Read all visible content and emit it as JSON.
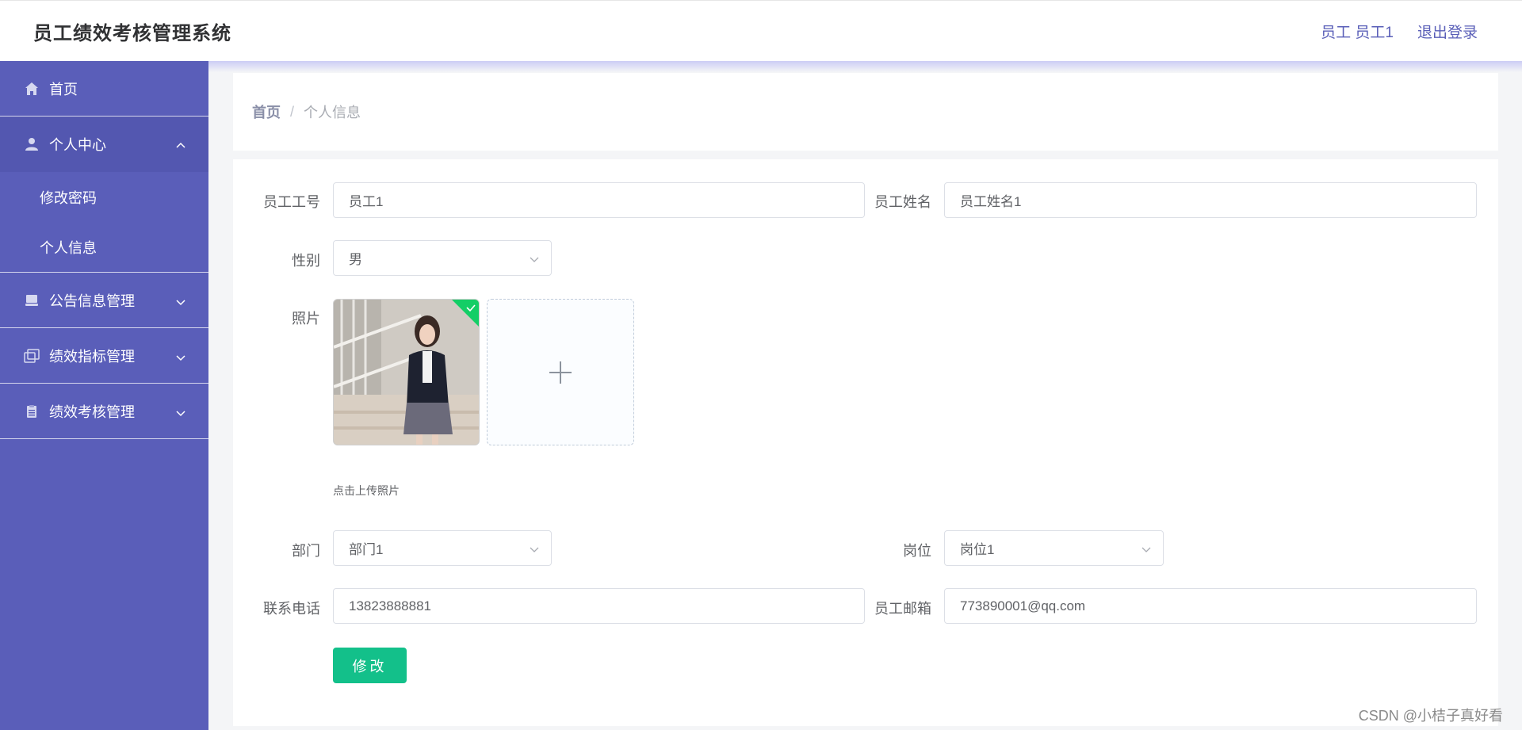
{
  "app": {
    "title": "员工绩效考核管理系统"
  },
  "header": {
    "user_label": "员工 员工1",
    "logout_label": "退出登录"
  },
  "sidebar": {
    "home": {
      "label": "首页",
      "icon": "home-icon"
    },
    "personal_center": {
      "label": "个人中心",
      "icon": "user-icon",
      "expanded": true,
      "children": [
        {
          "label": "修改密码"
        },
        {
          "label": "个人信息"
        }
      ]
    },
    "items": [
      {
        "label": "公告信息管理",
        "icon": "monitor-icon"
      },
      {
        "label": "绩效指标管理",
        "icon": "copy-icon"
      },
      {
        "label": "绩效考核管理",
        "icon": "clipboard-icon"
      }
    ]
  },
  "breadcrumb": {
    "home": "首页",
    "separator": "/",
    "current": "个人信息"
  },
  "form": {
    "employee_no": {
      "label": "员工工号",
      "value": "员工1"
    },
    "employee_name": {
      "label": "员工姓名",
      "value": "员工姓名1"
    },
    "gender": {
      "label": "性别",
      "value": "男"
    },
    "photo": {
      "label": "照片",
      "tip": "点击上传照片"
    },
    "department": {
      "label": "部门",
      "value": "部门1"
    },
    "position": {
      "label": "岗位",
      "value": "岗位1"
    },
    "phone": {
      "label": "联系电话",
      "value": "13823888881"
    },
    "email": {
      "label": "员工邮箱",
      "value": "773890001@qq.com"
    },
    "submit_label": "修改"
  },
  "watermark": "CSDN @小桔子真好看",
  "colors": {
    "sidebar": "#5a5eb9",
    "accent": "#13c08a",
    "header_link": "#5a5fb8"
  }
}
